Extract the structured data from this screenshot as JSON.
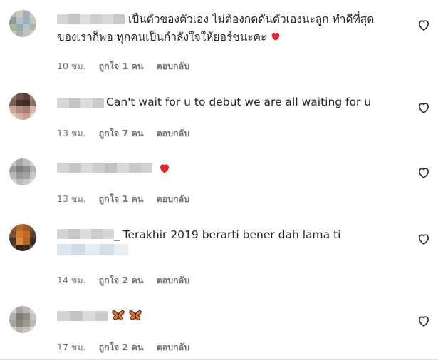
{
  "comments": [
    {
      "line1": "เป็นตัวของตัวเอง ไม่ต้องกดดันตัวเองนะลูก ทำดีที่สุด",
      "line2": "ของเราก็พอ ทุกคนเป็นกำลังใจให้ยอร์ชนะคะ",
      "time": "10 ชม.",
      "likes": "ถูกใจ 1 คน",
      "reply": "ตอบกลับ"
    },
    {
      "line1": "Can't wait for u to debut we are all waiting for u",
      "time": "13 ชม.",
      "likes": "ถูกใจ 7 คน",
      "reply": "ตอบกลับ"
    },
    {
      "time": "13 ชม.",
      "likes": "ถูกใจ 1 คน",
      "reply": "ตอบกลับ"
    },
    {
      "line1": "_ Terakhir 2019 berarti bener dah lama ti",
      "time": "14 ชม.",
      "likes": "ถูกใจ 2 คน",
      "reply": "ตอบกลับ"
    },
    {
      "time": "17 ชม.",
      "likes": "ถูกใจ 2 คน",
      "reply": "ตอบกลับ"
    }
  ],
  "icons": {
    "like": "heart-outline-icon",
    "red_heart": "red-heart-emoji",
    "butterfly": "butterfly-emoji"
  },
  "colors": {
    "text": "#262626",
    "meta": "#737373",
    "heart": "#ed4956"
  }
}
